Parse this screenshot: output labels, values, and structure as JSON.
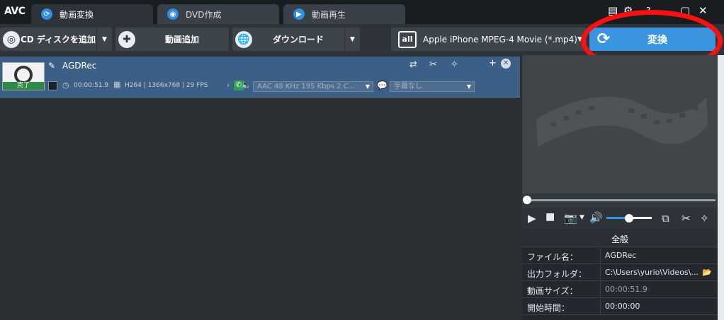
{
  "app": {
    "logo": "AVC"
  },
  "tabs": [
    {
      "label": "動画変換",
      "icon": "refresh-icon"
    },
    {
      "label": "DVD作成",
      "icon": "disc-icon"
    },
    {
      "label": "動画再生",
      "icon": "play-icon"
    }
  ],
  "toolbar": {
    "add_cd": "CD ディスクを追加",
    "add_video": "動画追加",
    "download": "ダウンロード",
    "profile": "Apple iPhone MPEG-4 Movie (*.mp4)",
    "profile_icon_text": "all",
    "convert": "変換"
  },
  "file": {
    "name": "AGDRec",
    "status": "完了",
    "duration": "00:00:51.9",
    "video_info": "H264 | 1366x768 | 29 FPS",
    "audio": "AAC 48 KHz 195 Kbps 2 C...",
    "subtitle": "字幕なし"
  },
  "player": {
    "seek_progress": 0,
    "volume_level": 0.5
  },
  "properties": {
    "header": "全般",
    "rows": [
      {
        "key": "ファイル名：",
        "value": "AGDRec"
      },
      {
        "key": "出力フォルダ：",
        "value": "C:\\Users\\yurio\\Videos\\..."
      },
      {
        "key": "動画サイズ：",
        "value": "00:00:51.9"
      },
      {
        "key": "開始時間：",
        "value": "00:00:00"
      }
    ]
  },
  "colors": {
    "accent": "#3a94e0",
    "annotation": "#ff1010",
    "selected_row": "#3c5f85",
    "done_badge": "#2f8a4a"
  }
}
